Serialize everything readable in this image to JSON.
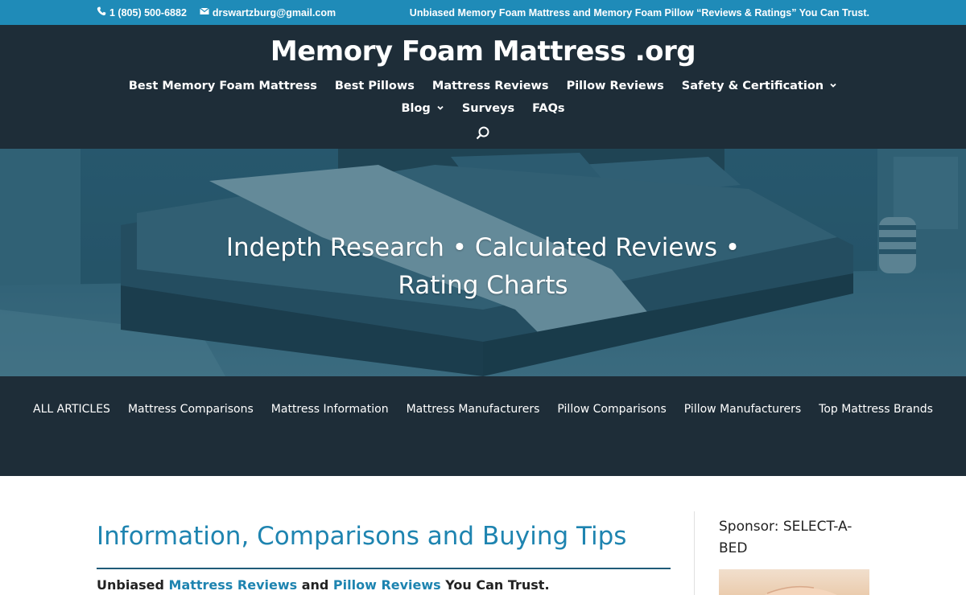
{
  "topbar": {
    "phone": "1 (805) 500-6882",
    "email": "drswartzburg@gmail.com",
    "tagline": "Unbiased Memory Foam Mattress and Memory Foam Pillow “Reviews & Ratings” You Can Trust."
  },
  "header": {
    "logo": "Memory Foam Mattress .org",
    "nav": [
      {
        "label": "Best Memory Foam Mattress"
      },
      {
        "label": "Best Pillows"
      },
      {
        "label": "Mattress Reviews"
      },
      {
        "label": "Pillow Reviews"
      },
      {
        "label": "Safety & Certification"
      },
      {
        "label": "Blog"
      },
      {
        "label": "Surveys"
      },
      {
        "label": "FAQs"
      }
    ]
  },
  "hero": {
    "title": "Indepth Research • Calculated Reviews • Rating Charts"
  },
  "categories": [
    "ALL ARTICLES",
    "Mattress Comparisons",
    "Mattress Information",
    "Mattress Manufacturers",
    "Pillow Comparisons",
    "Pillow Manufacturers",
    "Top Mattress Brands"
  ],
  "main": {
    "heading": "Information, Comparisons and Buying Tips",
    "intro_prefix": "Unbiased ",
    "intro_link1": "Mattress Reviews",
    "intro_and": " and ",
    "intro_link2": "Pillow Reviews",
    "intro_suffix": " You Can Trust."
  },
  "sidebar": {
    "title": "Sponsor: SELECT-A-BED"
  },
  "icons": {
    "phone": "phone-icon",
    "email": "envelope-icon",
    "dropdown": "chevron-down-icon",
    "search": "search-icon"
  }
}
